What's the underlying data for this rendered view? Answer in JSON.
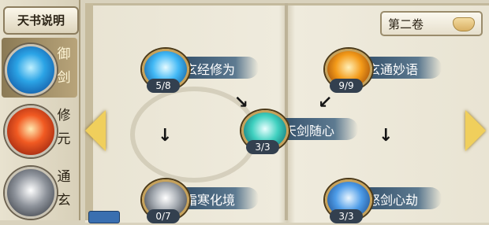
{
  "sidebar": {
    "help_label": "天书说明",
    "tabs": [
      {
        "label": "御剑",
        "selected": true,
        "icon": "blue-orb-icon"
      },
      {
        "label": "修元",
        "selected": false,
        "icon": "red-orb-icon"
      },
      {
        "label": "通玄",
        "selected": false,
        "icon": "silver-orb-icon"
      }
    ]
  },
  "volume": {
    "label": "第二卷"
  },
  "skills": [
    {
      "name": "玄经修为",
      "count": "5/8",
      "icon": "ice-crystal-icon"
    },
    {
      "name": "玄通妙语",
      "count": "9/9",
      "icon": "flame-scroll-icon"
    },
    {
      "name": "天剑随心",
      "count": "3/3",
      "icon": "jade-sword-icon"
    },
    {
      "name": "霜寒化境",
      "count": "0/7",
      "icon": "frost-icon"
    },
    {
      "name": "怒剑心劫",
      "count": "3/3",
      "icon": "blade-icon"
    }
  ],
  "colors": {
    "accent": "#f0cf5c",
    "banner": "#2d5578"
  }
}
